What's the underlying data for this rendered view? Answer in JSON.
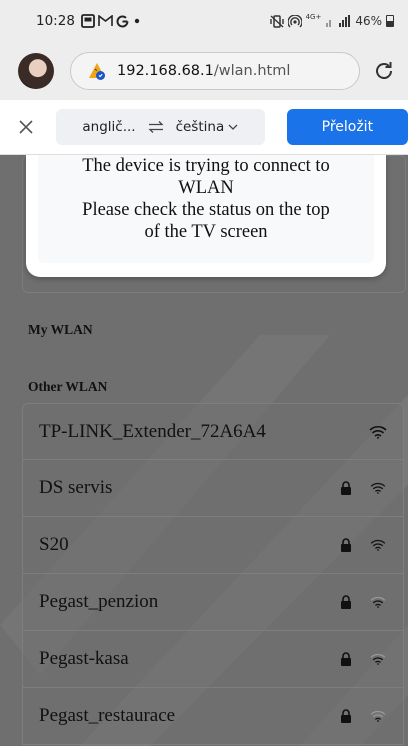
{
  "status_bar": {
    "time": "10:28",
    "left_icons": [
      "gallery-icon",
      "gmail-icon",
      "google-icon",
      "dot-icon"
    ],
    "right_icons": [
      "mute-vibrate-icon",
      "wifi-hotspot-icon",
      "signal-icon"
    ],
    "network_label": "4G+",
    "battery_percent": "46%"
  },
  "browser": {
    "url_host": "192.168.68.1",
    "url_path": "/wlan.html"
  },
  "translate_bar": {
    "source_lang": "anglič...",
    "target_lang": "čeština",
    "translate_button": "Přeložit"
  },
  "dialog": {
    "line1": "The device is trying to connect to",
    "line2": "WLAN",
    "line3": "Please check the status on the top",
    "line4": "of the TV screen"
  },
  "sections": {
    "my_wlan": "My WLAN",
    "other_wlan": "Other WLAN"
  },
  "networks": [
    {
      "name": "TP-LINK_Extender_72A6A4",
      "locked": false,
      "signal": "strong"
    },
    {
      "name": "DS servis",
      "locked": true,
      "signal": "strong"
    },
    {
      "name": "S20",
      "locked": true,
      "signal": "strong"
    },
    {
      "name": "Pegast_penzion",
      "locked": true,
      "signal": "medium"
    },
    {
      "name": "Pegast-kasa",
      "locked": true,
      "signal": "medium"
    },
    {
      "name": "Pegast_restaurace",
      "locked": true,
      "signal": "weak"
    }
  ],
  "colors": {
    "accent": "#1a73e8",
    "overlay": "#6f6f6f",
    "status_bg": "#ededed"
  }
}
